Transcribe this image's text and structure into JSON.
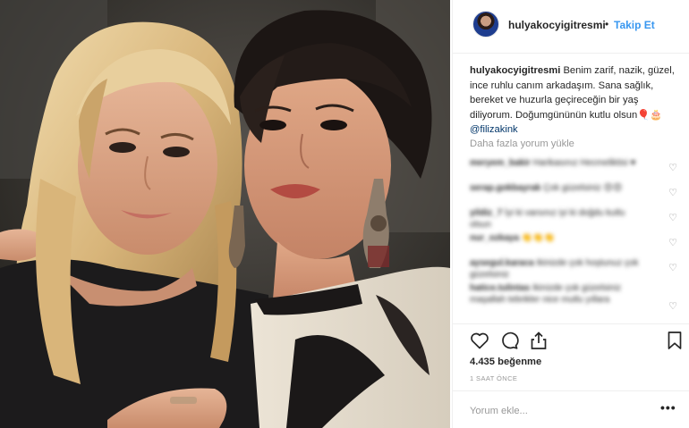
{
  "post": {
    "username": "hulyakocyigitresmi",
    "separator": "•",
    "follow_label": "Takip Et",
    "caption_user": "hulyakocyigitresmi",
    "caption_text": "Benim zarif, nazik, güzel, ince ruhlu canım arkadaşım. Sana sağlık, bereket ve huzurla geçireceğin bir yaş diliyorum. Doğumgününün kutlu olsun",
    "caption_emoji": "🎈🎂",
    "caption_mention": "@filizakink",
    "load_more_label": "Daha fazla yorum yükle",
    "likes": "4.435 beğenme",
    "timestamp": "1 SAAT ÖNCE",
    "comment_placeholder": "Yorum ekle...",
    "more_icon": "•••"
  },
  "comments": [
    {
      "user": "meryem_bakir",
      "text": "Harikasınız Hecmeliktisi ♥"
    },
    {
      "user": "serap.gokbayrak",
      "text": "Çok güzelsiniz 😍😍"
    },
    {
      "user": "yildiz_7",
      "text": "İyi ki varsınız iyi ki doğdu kutlu olsun"
    },
    {
      "user": "nur_ozkaya",
      "text": "👏👏👏"
    },
    {
      "user": "aysegul.karaca",
      "text": "Ikinizde çok hoştunuz çok güzelsiniz"
    },
    {
      "user": "hatice.tulintas",
      "text": "Ikinizde çok güzelsiniz maşallah tebrikler nice mutlu yıllara"
    }
  ],
  "icons": {
    "like": "heart-icon",
    "comment": "speech-bubble-icon",
    "share": "share-icon",
    "save": "bookmark-icon",
    "comment_like": "small-heart-icon"
  },
  "colors": {
    "accent": "#3897f0",
    "text": "#262626",
    "muted": "#999999",
    "border": "#efefef"
  }
}
